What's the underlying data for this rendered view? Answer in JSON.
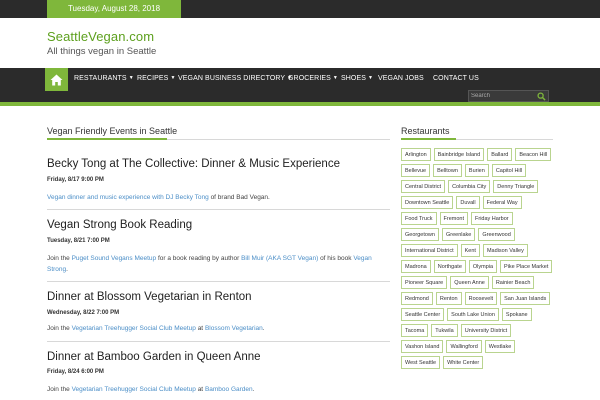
{
  "topbar": {
    "date": "Tuesday, August 28, 2018"
  },
  "site": {
    "title": "SeattleVegan.com",
    "description": "All things vegan in Seattle"
  },
  "nav": {
    "items": [
      {
        "label": "RESTAURANTS",
        "dropdown": true
      },
      {
        "label": "RECIPES",
        "dropdown": true
      },
      {
        "label": "VEGAN BUSINESS DIRECTORY",
        "dropdown": true
      },
      {
        "label": "GROCERIES",
        "dropdown": true
      },
      {
        "label": "SHOES",
        "dropdown": true
      },
      {
        "label": "VEGAN JOBS",
        "dropdown": false
      },
      {
        "label": "CONTACT US",
        "dropdown": false
      }
    ],
    "search_placeholder": "Search"
  },
  "main": {
    "heading": "Vegan Friendly Events in Seattle",
    "events": [
      {
        "title": "Becky Tong at The Collective: Dinner & Music Experience",
        "date": "Friday, 8/17 9:00 PM",
        "desc_link": "Vegan dinner and music experience with DJ Becky Tong",
        "desc_text": " of brand Bad Vegan."
      },
      {
        "title": "Vegan Strong Book Reading",
        "date": "Tuesday, 8/21 7:00 PM",
        "desc_pre": "Join the ",
        "desc_link1": "Puget Sound Vegans Meetup",
        "desc_mid": " for a book reading by author ",
        "desc_link2": "Bill Muir (AKA SGT Vegan)",
        "desc_mid2": " of his book ",
        "desc_link3": "Vegan Strong",
        "desc_end": "."
      },
      {
        "title": "Dinner at Blossom Vegetarian in Renton",
        "date": "Wednesday, 8/22 7:00 PM",
        "desc_pre": "Join the ",
        "desc_link1": "Vegetarian Treehugger Social Club Meetup",
        "desc_mid": " at ",
        "desc_link2": "Blossom Vegetarian",
        "desc_end": "."
      },
      {
        "title": "Dinner at Bamboo Garden in Queen Anne",
        "date": "Friday, 8/24 6:00 PM",
        "desc_pre": "Join the ",
        "desc_link1": "Vegetarian Treehugger Social Club Meetup",
        "desc_mid": " at ",
        "desc_link2": "Bamboo Garden",
        "desc_end": "."
      }
    ]
  },
  "sidebar": {
    "heading": "Restaurants",
    "tags": [
      "Arlington",
      "Bainbridge Island",
      "Ballard",
      "Beacon Hill",
      "Bellevue",
      "Belltown",
      "Burien",
      "Capitol Hill",
      "Central District",
      "Columbia City",
      "Denny Triangle",
      "Downtown Seattle",
      "Duvall",
      "Federal Way",
      "Food Truck",
      "Fremont",
      "Friday Harbor",
      "Georgetown",
      "Greenlake",
      "Greenwood",
      "International District",
      "Kent",
      "Madison Valley",
      "Madrona",
      "Northgate",
      "Olympia",
      "Pike Place Market",
      "Pioneer Square",
      "Queen Anne",
      "Rainier Beach",
      "Redmond",
      "Renton",
      "Roosevelt",
      "San Juan Islands",
      "Seattle Center",
      "South Lake Union",
      "Spokane",
      "Tacoma",
      "Tukwila",
      "University District",
      "Vashon Island",
      "Wallingford",
      "Westlake",
      "West Seattle",
      "White Center"
    ]
  },
  "colors": {
    "accent": "#7fb73b",
    "dark": "#2b2b2b",
    "link": "#4b8ec7"
  },
  "icons": {
    "home": "home-icon",
    "search": "search-icon"
  }
}
